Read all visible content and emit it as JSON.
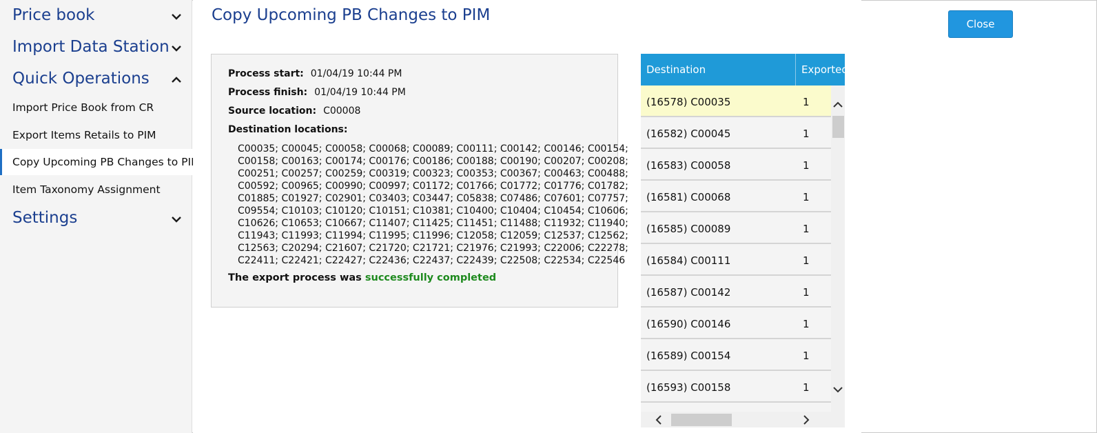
{
  "sidebar": {
    "groups": [
      {
        "label": "Price book",
        "expanded": false
      },
      {
        "label": "Import Data Station",
        "expanded": false
      },
      {
        "label": "Quick Operations",
        "expanded": true
      },
      {
        "label": "Settings",
        "expanded": false
      }
    ],
    "items": [
      {
        "label": "Import Price Book from CR",
        "active": false
      },
      {
        "label": "Export Items Retails to PIM",
        "active": false
      },
      {
        "label": "Copy Upcoming PB Changes to PIM",
        "active": true
      },
      {
        "label": "Item Taxonomy Assignment",
        "active": false
      }
    ]
  },
  "main": {
    "title": "Copy Upcoming PB Changes to PIM",
    "process_start_label": "Process start:",
    "process_start_value": "01/04/19 10:44 PM",
    "process_finish_label": "Process finish:",
    "process_finish_value": "01/04/19 10:44 PM",
    "source_location_label": "Source location:",
    "source_location_value": "C00008",
    "destination_locations_label": "Destination locations:",
    "destination_lines": [
      "C00035; C00045; C00058; C00068; C00089; C00111; C00142; C00146; C00154;",
      "C00158; C00163; C00174; C00176; C00186; C00188; C00190; C00207; C00208;",
      "C00251; C00257; C00259; C00319; C00323; C00353; C00367; C00463; C00488;",
      "C00592; C00965; C00990; C00997; C01172; C01766; C01772; C01776; C01782;",
      "C01885; C01927; C02901; C03403; C03447; C05838; C07486; C07601; C07757;",
      "C09554; C10103; C10120; C10151; C10381; C10400; C10404; C10454; C10606;",
      "C10626; C10653; C10667; C11407; C11425; C11451; C11488; C11932; C11940;",
      "C11943; C11993; C11994; C11995; C11996; C12058; C12059; C12537; C12562;",
      "C12563; C20294; C21607; C21720; C21721; C21976; C21993; C22006; C22278;",
      "C22411; C22421; C22427; C22436; C22437; C22439; C22508; C22534; C22546"
    ],
    "result_prefix": "The export process was",
    "result_status": "successfully completed"
  },
  "grid": {
    "columns": [
      "Destination",
      "Exported"
    ],
    "rows": [
      {
        "destination": "(16578) C00035",
        "exported": "1",
        "selected": true
      },
      {
        "destination": "(16582) C00045",
        "exported": "1",
        "selected": false
      },
      {
        "destination": "(16583) C00058",
        "exported": "1",
        "selected": false
      },
      {
        "destination": "(16581) C00068",
        "exported": "1",
        "selected": false
      },
      {
        "destination": "(16585) C00089",
        "exported": "1",
        "selected": false
      },
      {
        "destination": "(16584) C00111",
        "exported": "1",
        "selected": false
      },
      {
        "destination": "(16587) C00142",
        "exported": "1",
        "selected": false
      },
      {
        "destination": "(16590) C00146",
        "exported": "1",
        "selected": false
      },
      {
        "destination": "(16589) C00154",
        "exported": "1",
        "selected": false
      },
      {
        "destination": "(16593) C00158",
        "exported": "1",
        "selected": false
      }
    ]
  },
  "actions": {
    "close_label": "Close"
  },
  "colors": {
    "accent": "#1f9ad8",
    "title_blue": "#1b3f8f",
    "success": "#1e8a1e",
    "selected_row": "#fbfbcc"
  }
}
